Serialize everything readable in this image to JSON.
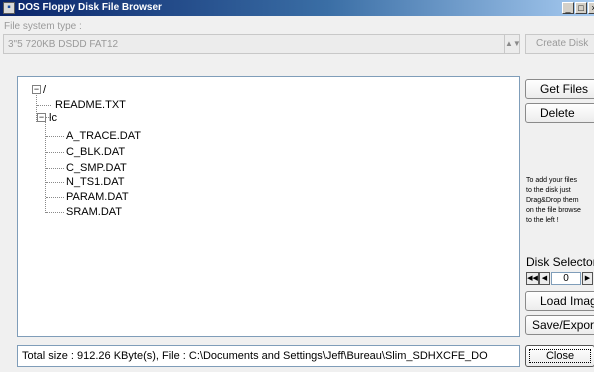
{
  "window": {
    "title": "DOS Floppy Disk File Browser",
    "icon": "floppy-app-icon",
    "controls": {
      "minimize": "_",
      "maximize": "□",
      "close": "×"
    }
  },
  "filesystem": {
    "label": "File system type :",
    "selected": "3\"5     720KB DSDD FAT12",
    "create_disk_label": "Create Disk"
  },
  "tree": {
    "root": {
      "label": "/",
      "expander": "−"
    },
    "root_files": [
      "README.TXT"
    ],
    "folder": {
      "label": "lc",
      "expander": "−"
    },
    "folder_files": [
      "A_TRACE.DAT",
      "C_BLK.DAT",
      "C_SMP.DAT",
      "N_TS1.DAT",
      "PARAM.DAT",
      "SRAM.DAT"
    ]
  },
  "actions": {
    "get_files": "Get Files",
    "delete": "Delete",
    "hint_lines": [
      "To add your files",
      "to the disk just",
      "Drag&Drop them",
      "on the file browse",
      "to the left !"
    ],
    "disk_selector_label": "Disk Selector",
    "disk_selector_value": "0",
    "spin_icons": {
      "first": "◀◀",
      "prev": "◀",
      "next": "▶",
      "last": "▶▶"
    },
    "load_image": "Load Image",
    "save_export": "Save/Export"
  },
  "status": {
    "text": "Total size : 912.26 KByte(s), File : C:\\Documents and Settings\\Jeff\\Bureau\\Slim_SDHXCFE_DO"
  },
  "close_label": "Close",
  "colors": {
    "titlebar_start": "#0a246a",
    "titlebar_end": "#a6caf0",
    "panel": "#f0f0f0",
    "field_border": "#7f9db9",
    "disabled_text": "#9a9a9a"
  }
}
